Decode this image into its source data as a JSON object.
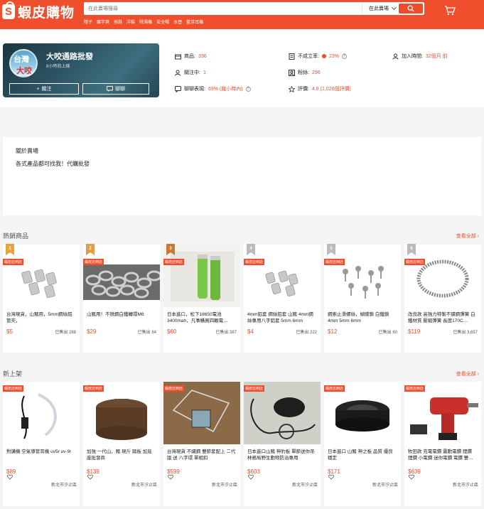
{
  "header": {
    "logo_text": "蝦皮購物",
    "search_placeholder": "在此賣場搜尋",
    "search_scope": "在此賣場",
    "hot_words": [
      "隱子",
      "魔芋爽",
      "拖鞋",
      "洋裝",
      "除濕機",
      "安全帽",
      "水壺",
      "藍芽耳機"
    ]
  },
  "shop": {
    "avatar_line1": "台灣",
    "avatar_line2": "大咬",
    "name": "大咬通路批發",
    "online": "8小時前上線",
    "follow_label": "關注",
    "chat_label": "聊聊"
  },
  "stats": {
    "products_label": "商品:",
    "products_value": "336",
    "following_label": "關注中:",
    "following_value": "1",
    "chat_label": "聊聊表現:",
    "chat_value": "69% (幾小時內)",
    "cancel_label": "不成立率:",
    "cancel_value": "23%",
    "fans_label": "粉絲:",
    "fans_value": "296",
    "rating_label": "評價:",
    "rating_value": "4.8 (1,026個評價)",
    "joined_label": "加入時間:",
    "joined_value": "32個月 前"
  },
  "about": {
    "heading": "關於賣場",
    "text": "各式產品都可找我！代購批發"
  },
  "hot_section": {
    "title": "熱銷商品",
    "see_all": "查看全部",
    "items": [
      {
        "rank": "1",
        "tag": "蝦皮店到店",
        "name": "台灣現貨，山豬用，5mm鋼絲鋁管夾，",
        "price": "$5",
        "sold": "已售出 288"
      },
      {
        "rank": "2",
        "tag": "蝦皮店到店",
        "name": "山豬用！不銹鋼白鐵轉環M6",
        "price": "$29",
        "sold": "已售出 84"
      },
      {
        "rank": "3",
        "tag": "蝦皮店到店",
        "name": "日本進口，松下18650電池3400mah，凡事購買四顆電…",
        "price": "$60",
        "sold": "已售出 387"
      },
      {
        "rank": "4",
        "tag": "蝦皮店到店",
        "name": "4mm鋁套 鋼絲鋁套 山豬 4mm鋼絲專用八字鋁套 5mm 6mm",
        "price": "$4",
        "sold": "已售出 222"
      },
      {
        "rank": "5",
        "tag": "蝦皮店到店",
        "name": "鋼索止滑螺絲，蝴蝶鎖 白鐵鎖4mm 5mm 6mm",
        "price": "$12",
        "sold": "已售出 60"
      },
      {
        "rank": "6",
        "tag": "蝦皮店到店",
        "name": "改良款 高強力特製不鏽鋼彈簧 白鐵材質 壓縮彈簧 長度170C…",
        "price": "$119",
        "sold": "已售出 3,657"
      }
    ]
  },
  "new_section": {
    "title": "新上架",
    "see_all": "查看全部",
    "items": [
      {
        "tag": "蝦皮店到店",
        "name": "對講機 空氣導管耳機 uv5r uv-9r",
        "price": "$89",
        "location": "新北市汐止區"
      },
      {
        "tag": "蝦皮店到店",
        "name": "加強 一代山，豬 現斤 踏板 加底座批發商",
        "price": "$139",
        "location": "新北市汐止區"
      },
      {
        "tag": "蝦皮店到店",
        "name": "台灣現貨 不繡鋼 雙節套配上 二代版 送 八字環 單相扣",
        "price": "$599",
        "location": "新北市汐止區"
      },
      {
        "tag": "蝦皮店到店",
        "name": "日本進口山豬 神豹板 單節送你吊 林務局野生動物防治專用",
        "price": "$603",
        "location": "新北市汐止區"
      },
      {
        "tag": "蝦皮店到店",
        "name": "日本進口 山豬 神之板 品質 優良穩定",
        "price": "$171",
        "location": "新北市汐止區"
      },
      {
        "tag": "蝦皮店到店",
        "name": "牧田款 充電電鑽 震動電鑽 鋰鑽 鋰鑽 小電鑽 迷你電鑽 電鑽 雙…",
        "price": "$639",
        "location": "新北市汐止區"
      }
    ]
  },
  "colors": {
    "brand": "#ee4d2d",
    "header": "#f04f2d"
  }
}
